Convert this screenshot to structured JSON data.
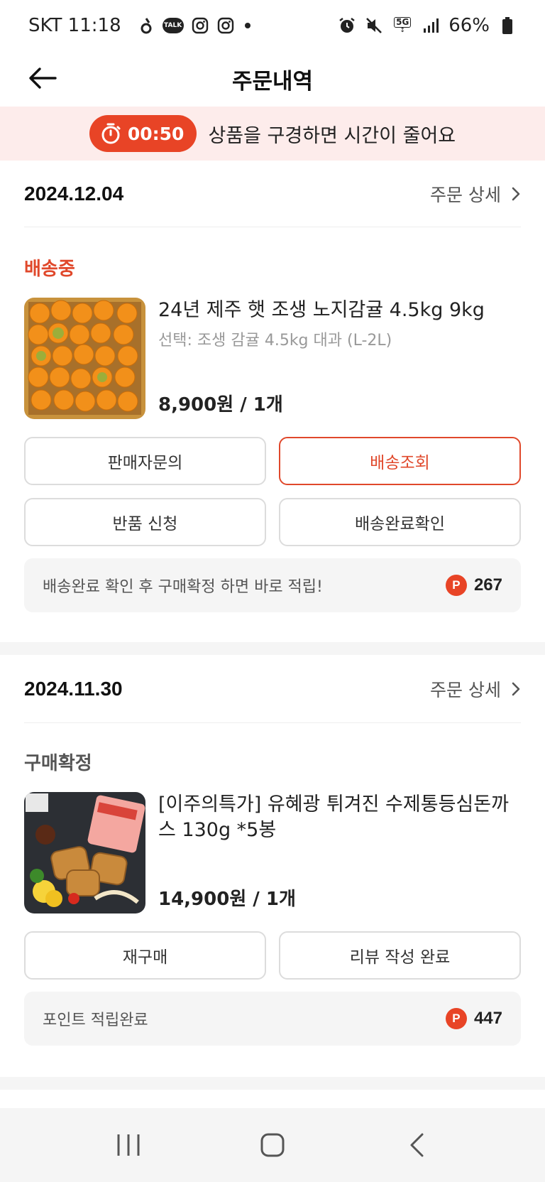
{
  "status_bar": {
    "carrier_time": "SKT 11:18",
    "talk_label": "TALK",
    "network": "5G",
    "battery": "66%"
  },
  "header": {
    "title": "주문내역",
    "back_icon": "arrow-left-icon"
  },
  "timer_banner": {
    "time": "00:50",
    "message": "상품을 구경하면 시간이 줄어요",
    "background": "#fdeceb",
    "accent": "#e84426"
  },
  "orders": [
    {
      "date": "2024.12.04",
      "detail_label": "주문 상세",
      "status": "배송중",
      "status_color": "#e0482b",
      "product_name": "24년 제주 햇 조생 노지감귤 4.5kg 9kg",
      "product_option": "선택: 조생 감귤 4.5kg 대과 (L-2L)",
      "price": "8,900원 / 1개",
      "buttons": [
        "판매자문의",
        "배송조회",
        "반품 신청",
        "배송완료확인"
      ],
      "point_text": "배송완료 확인 후 구매확정 하면 바로 적립!",
      "point_value": "267",
      "point_badge": "P"
    },
    {
      "date": "2024.11.30",
      "detail_label": "주문 상세",
      "status": "구매확정",
      "status_color": "#555555",
      "product_name": "[이주의특가] 유혜광 튀겨진 수제통등심돈까스 130g *5봉",
      "price": "14,900원 / 1개",
      "buttons": [
        "재구매",
        "리뷰 작성 완료"
      ],
      "point_text": "포인트 적립완료",
      "point_value": "447",
      "point_badge": "P"
    }
  ]
}
